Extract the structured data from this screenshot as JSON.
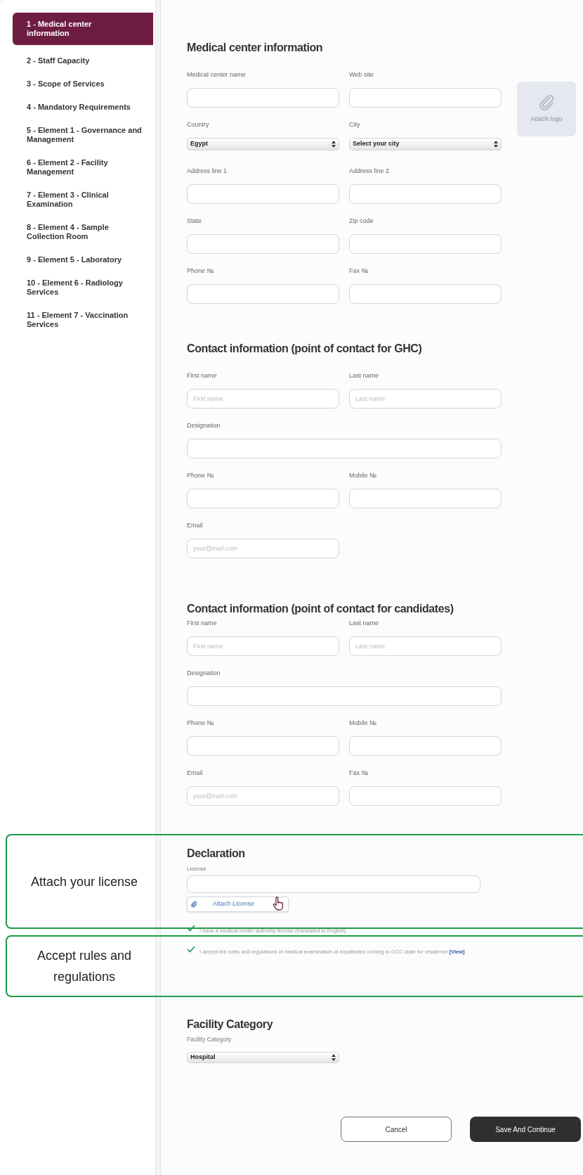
{
  "sidebar": {
    "items": [
      {
        "label": "1 - Medical center information",
        "selected": true
      },
      {
        "label": "2 - Staff Capacity",
        "selected": false
      },
      {
        "label": "3 - Scope of Services",
        "selected": false
      },
      {
        "label": "4 - Mandatory Requirements",
        "selected": false
      },
      {
        "label": "5 - Element 1 - Governance and Management",
        "selected": false
      },
      {
        "label": "6 - Element 2 - Facility Management",
        "selected": false
      },
      {
        "label": "7 - Element 3 - Clinical Examination",
        "selected": false
      },
      {
        "label": "8 - Element 4 - Sample Collection Room",
        "selected": false
      },
      {
        "label": "9 - Element 5 - Laboratory",
        "selected": false
      },
      {
        "label": "10 - Element 6 - Radiology Services",
        "selected": false
      },
      {
        "label": "11 - Element 7 - Vaccination Services",
        "selected": false
      }
    ]
  },
  "sections": [
    {
      "title": "Medical center information",
      "logo_button": {
        "label": "Attach logo"
      },
      "rows": [
        [
          {
            "label": "Medical center name",
            "kind": "text"
          },
          {
            "label": "Web site",
            "kind": "text"
          }
        ],
        [
          {
            "label": "Country",
            "kind": "select",
            "value": "Egypt"
          },
          {
            "label": "City",
            "kind": "select",
            "value": "Select your city"
          }
        ],
        [
          {
            "label": "Address line 1",
            "kind": "text"
          },
          {
            "label": "Address line 2",
            "kind": "text"
          }
        ],
        [
          {
            "label": "State",
            "kind": "text"
          },
          {
            "label": "Zip code",
            "kind": "text"
          }
        ],
        [
          {
            "label": "Phone №",
            "kind": "text"
          },
          {
            "label": "Fax №",
            "kind": "text"
          }
        ]
      ]
    },
    {
      "title": "Contact information (point of contact for GHC)",
      "rows": [
        [
          {
            "label": "First name",
            "kind": "text",
            "placeholder": "First name"
          },
          {
            "label": "Last name",
            "kind": "text",
            "placeholder": "Last name"
          }
        ],
        [
          {
            "label": "Designation",
            "kind": "text_wide"
          }
        ],
        [
          {
            "label": "Phone №",
            "kind": "text"
          },
          {
            "label": "Mobile №",
            "kind": "text"
          }
        ],
        [
          {
            "label": "Email",
            "kind": "text",
            "placeholder": "your@mail.com"
          }
        ]
      ]
    },
    {
      "title": "Contact information (point of contact for candidates)",
      "rows": [
        [
          {
            "label": "First name",
            "kind": "text",
            "placeholder": "First name"
          },
          {
            "label": "Last name",
            "kind": "text",
            "placeholder": "Last name"
          }
        ],
        [
          {
            "label": "Designation",
            "kind": "text_wide"
          }
        ],
        [
          {
            "label": "Phone №",
            "kind": "text"
          },
          {
            "label": "Mobile №",
            "kind": "text"
          }
        ],
        [
          {
            "label": "Email",
            "kind": "text",
            "placeholder": "your@mail.com"
          },
          {
            "label": "Fax №",
            "kind": "text"
          }
        ]
      ]
    }
  ],
  "declaration": {
    "title": "Declaration",
    "license_label": "License",
    "attach_button": "Attach License",
    "checks": [
      {
        "text": "I have a medical center authority license (translated to English)",
        "checked": true
      },
      {
        "text": "I accept the rules and regulations of medical examination of expatriates coming to GCC state for residence",
        "link": "[View]",
        "checked": true
      }
    ]
  },
  "facility": {
    "title": "Facility Category",
    "label": "Facility Category",
    "value": "Hospital"
  },
  "buttons": [
    {
      "label": "Cancel",
      "kind": "secondary"
    },
    {
      "label": "Save And Continue",
      "kind": "primary"
    }
  ],
  "callouts": [
    {
      "text": "Attach your license"
    },
    {
      "text": "Accept rules and regulations"
    }
  ]
}
